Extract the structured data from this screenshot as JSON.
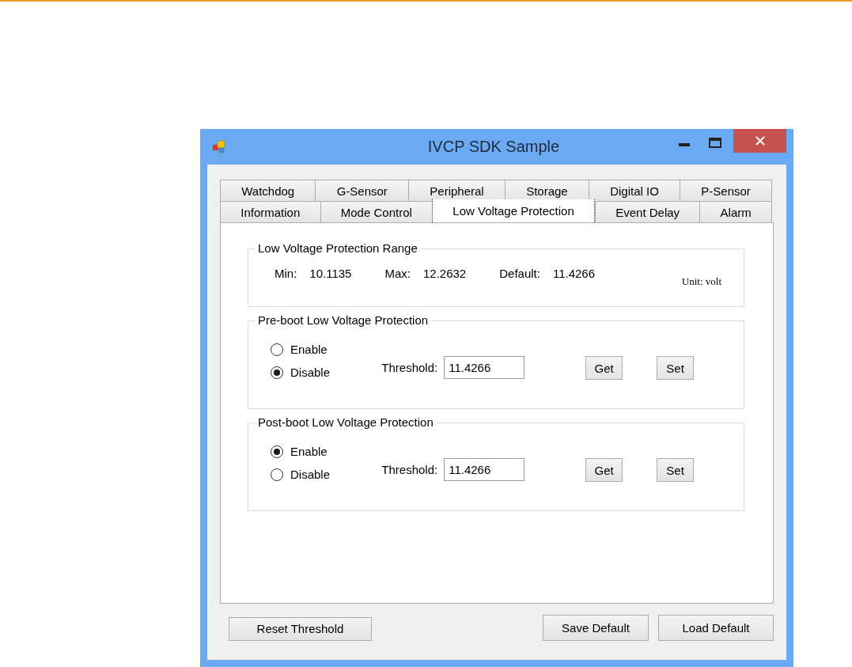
{
  "window": {
    "title": "IVCP SDK Sample"
  },
  "tab_rows": [
    {
      "tabs": [
        {
          "label": "Watchdog",
          "selected": false
        },
        {
          "label": "G-Sensor",
          "selected": false
        },
        {
          "label": "Peripheral",
          "selected": false
        },
        {
          "label": "Storage",
          "selected": false
        },
        {
          "label": "Digital IO",
          "selected": false
        },
        {
          "label": "P-Sensor",
          "selected": false
        }
      ]
    },
    {
      "tabs": [
        {
          "label": "Information",
          "selected": false
        },
        {
          "label": "Mode Control",
          "selected": false
        },
        {
          "label": "Low Voltage Protection",
          "selected": true
        },
        {
          "label": "Event Delay",
          "selected": false
        },
        {
          "label": "Alarm",
          "selected": false
        }
      ]
    }
  ],
  "range": {
    "title": "Low Voltage Protection Range",
    "items": [
      {
        "label": "Min:",
        "value": "10.1135"
      },
      {
        "label": "Max:",
        "value": "12.2632"
      },
      {
        "label": "Default:",
        "value": "11.4266"
      }
    ],
    "unit": "Unit: volt"
  },
  "groups": [
    {
      "title": "Pre-boot Low Voltage Protection",
      "options": [
        {
          "label": "Enable",
          "selected": false
        },
        {
          "label": "Disable",
          "selected": true
        }
      ],
      "threshold_label": "Threshold:",
      "threshold_value": "11.4266",
      "buttons": [
        "Get",
        "Set"
      ]
    },
    {
      "title": "Post-boot Low Voltage Protection",
      "options": [
        {
          "label": "Enable",
          "selected": true
        },
        {
          "label": "Disable",
          "selected": false
        }
      ],
      "threshold_label": "Threshold:",
      "threshold_value": "11.4266",
      "buttons": [
        "Get",
        "Set"
      ]
    }
  ],
  "footer": {
    "left": [
      "Reset Threshold"
    ],
    "right": [
      "Save Default",
      "Load Default"
    ]
  }
}
